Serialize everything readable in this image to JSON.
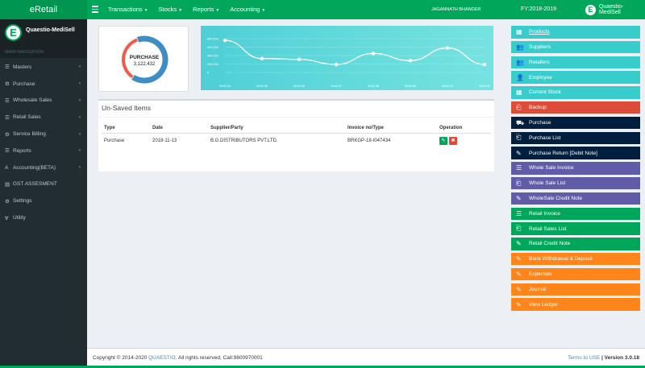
{
  "app": {
    "brand": "eRetail",
    "user": "JAGANNATH BHANDER",
    "fy": "FY:2018-2019",
    "company": "Quaestio-MediSell",
    "logo_letter": "E"
  },
  "topnav": [
    {
      "label": "Transactions"
    },
    {
      "label": "Stocks"
    },
    {
      "label": "Reports"
    },
    {
      "label": "Accounting"
    }
  ],
  "sidebar": {
    "section": "MAIN NAVIGATION",
    "items": [
      {
        "label": "Masters",
        "icon": "list-icon",
        "arrow": true
      },
      {
        "label": "Purchase",
        "icon": "gear-icon",
        "arrow": true
      },
      {
        "label": "Wholesale Sales",
        "icon": "list-icon",
        "arrow": true
      },
      {
        "label": "Retail Sales",
        "icon": "list-icon",
        "arrow": true
      },
      {
        "label": "Service Billing",
        "icon": "gear-icon",
        "arrow": true
      },
      {
        "label": "Reports",
        "icon": "list-icon",
        "arrow": true
      },
      {
        "label": "Accounting(BETA)",
        "icon": "accounting-icon",
        "arrow": true
      },
      {
        "label": "GST ASSESMENT",
        "icon": "doc-icon",
        "arrow": false
      },
      {
        "label": "Settings",
        "icon": "gear-icon",
        "arrow": false
      },
      {
        "label": "Utility",
        "icon": "utility-icon",
        "arrow": false
      }
    ]
  },
  "donut": {
    "label": "PURCHASE",
    "value": "3,122,432",
    "share": 0.64,
    "colors": {
      "primary": "#3d8ec3",
      "secondary": "#f05a4a"
    }
  },
  "chart_data": {
    "type": "line",
    "x": [
      "2018-04",
      "2018-05",
      "2018-06",
      "2018-07",
      "2018-08",
      "2018-09",
      "2018-10",
      "2018-11"
    ],
    "values": [
      760000,
      330000,
      310000,
      190000,
      450000,
      280000,
      580000,
      190000
    ],
    "yticks": [
      "800,000",
      "600,000",
      "400,000",
      "200,000",
      "0"
    ],
    "ylim": [
      0,
      800000
    ],
    "color": "#ffffff"
  },
  "unsaved": {
    "title": "Un-Saved Items",
    "columns": [
      "Type",
      "Date",
      "Supplier/Party",
      "Invoice no/Type",
      "Operation"
    ],
    "rows": [
      {
        "type": "Purchase",
        "date": "2018-11-13",
        "party": "B.G.DISTRIBUTORS PVT.LTD.",
        "invoice": "BRKGP-18-I047434"
      }
    ]
  },
  "quick_buttons": [
    {
      "label": "Products",
      "color": "#39cccc",
      "icon": "table-icon",
      "underline": true
    },
    {
      "label": "Suppliers",
      "color": "#39cccc",
      "icon": "users-icon"
    },
    {
      "label": "Retailers",
      "color": "#39cccc",
      "icon": "users-icon"
    },
    {
      "label": "Employee",
      "color": "#39cccc",
      "icon": "user-icon"
    },
    {
      "label": "Current Stock",
      "color": "#39cccc",
      "icon": "table-icon"
    },
    {
      "label": "Backup",
      "color": "#dd4b39",
      "icon": "inbox-icon"
    },
    {
      "label": "Purchase",
      "color": "#001f3f",
      "icon": "truck-icon"
    },
    {
      "label": "Purchase List",
      "color": "#001f3f",
      "icon": "inbox-icon"
    },
    {
      "label": "Purchase Return [Debit Note]",
      "color": "#001f3f",
      "icon": "pencil-icon"
    },
    {
      "label": "Whole Sale Invoice",
      "color": "#605ca8",
      "icon": "list-icon"
    },
    {
      "label": "Whole Sale List",
      "color": "#605ca8",
      "icon": "inbox-icon"
    },
    {
      "label": "WholeSale Credit Note",
      "color": "#605ca8",
      "icon": "pencil-icon"
    },
    {
      "label": "Retail Invoice",
      "color": "#00a65a",
      "icon": "list-icon"
    },
    {
      "label": "Retail Sales List",
      "color": "#00a65a",
      "icon": "inbox-icon"
    },
    {
      "label": "Retail Credit Note",
      "color": "#00a65a",
      "icon": "pencil-icon"
    },
    {
      "label": "Bank Withdrawal & Deposit",
      "color": "#ff851b",
      "icon": "pencil-icon"
    },
    {
      "label": "Expenses",
      "color": "#ff851b",
      "icon": "pencil-icon"
    },
    {
      "label": "Journal",
      "color": "#ff851b",
      "icon": "pencil-icon"
    },
    {
      "label": "View Ledger",
      "color": "#ff851b",
      "icon": "pencil-icon"
    }
  ],
  "footer": {
    "copyright": "Copyright © 2014-2020",
    "company_link": "QUAESTIO.",
    "rights": "All rights reserved, Call:9800970001",
    "terms": "Terms to USE",
    "version": "| Version 3.0.18"
  }
}
